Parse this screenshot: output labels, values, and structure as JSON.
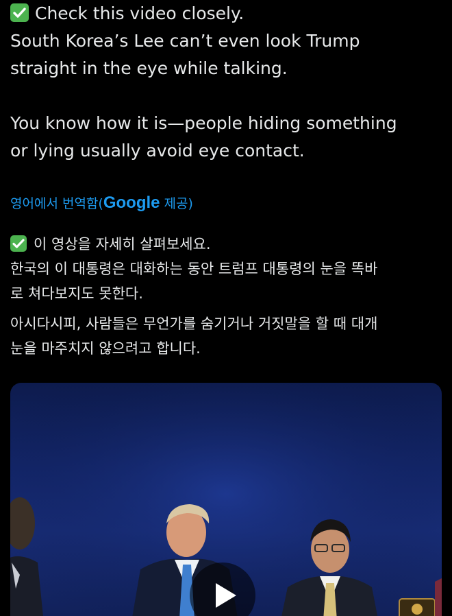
{
  "tweet": {
    "original_lines": [
      "Check this video closely.",
      "South Korea’s Lee can’t even look Trump",
      "straight in the eye while talking.",
      "You know how it is—people hiding something",
      "or lying usually avoid eye contact."
    ]
  },
  "translation": {
    "label_prefix": "영어에서 번역함(",
    "provider": "Google",
    "label_suffix": " 제공)",
    "lines": [
      "이 영상을 자세히 살펴보세요.",
      "한국의 이 대통령은 대화하는 동안 트럼프 대통령의 눈을 똑바",
      "로 쳐다보지도 못한다.",
      "아시다시피, 사람들은 무언가를 숨기거나 거짓말을 할 때 대개",
      "눈을 마주치지 않으려고 합니다."
    ]
  },
  "media": {
    "type": "video",
    "play_icon": "play-icon"
  },
  "colors": {
    "background": "#000000",
    "text": "#e7e9ea",
    "link": "#1d9bf0",
    "check": "#4cb34f"
  }
}
